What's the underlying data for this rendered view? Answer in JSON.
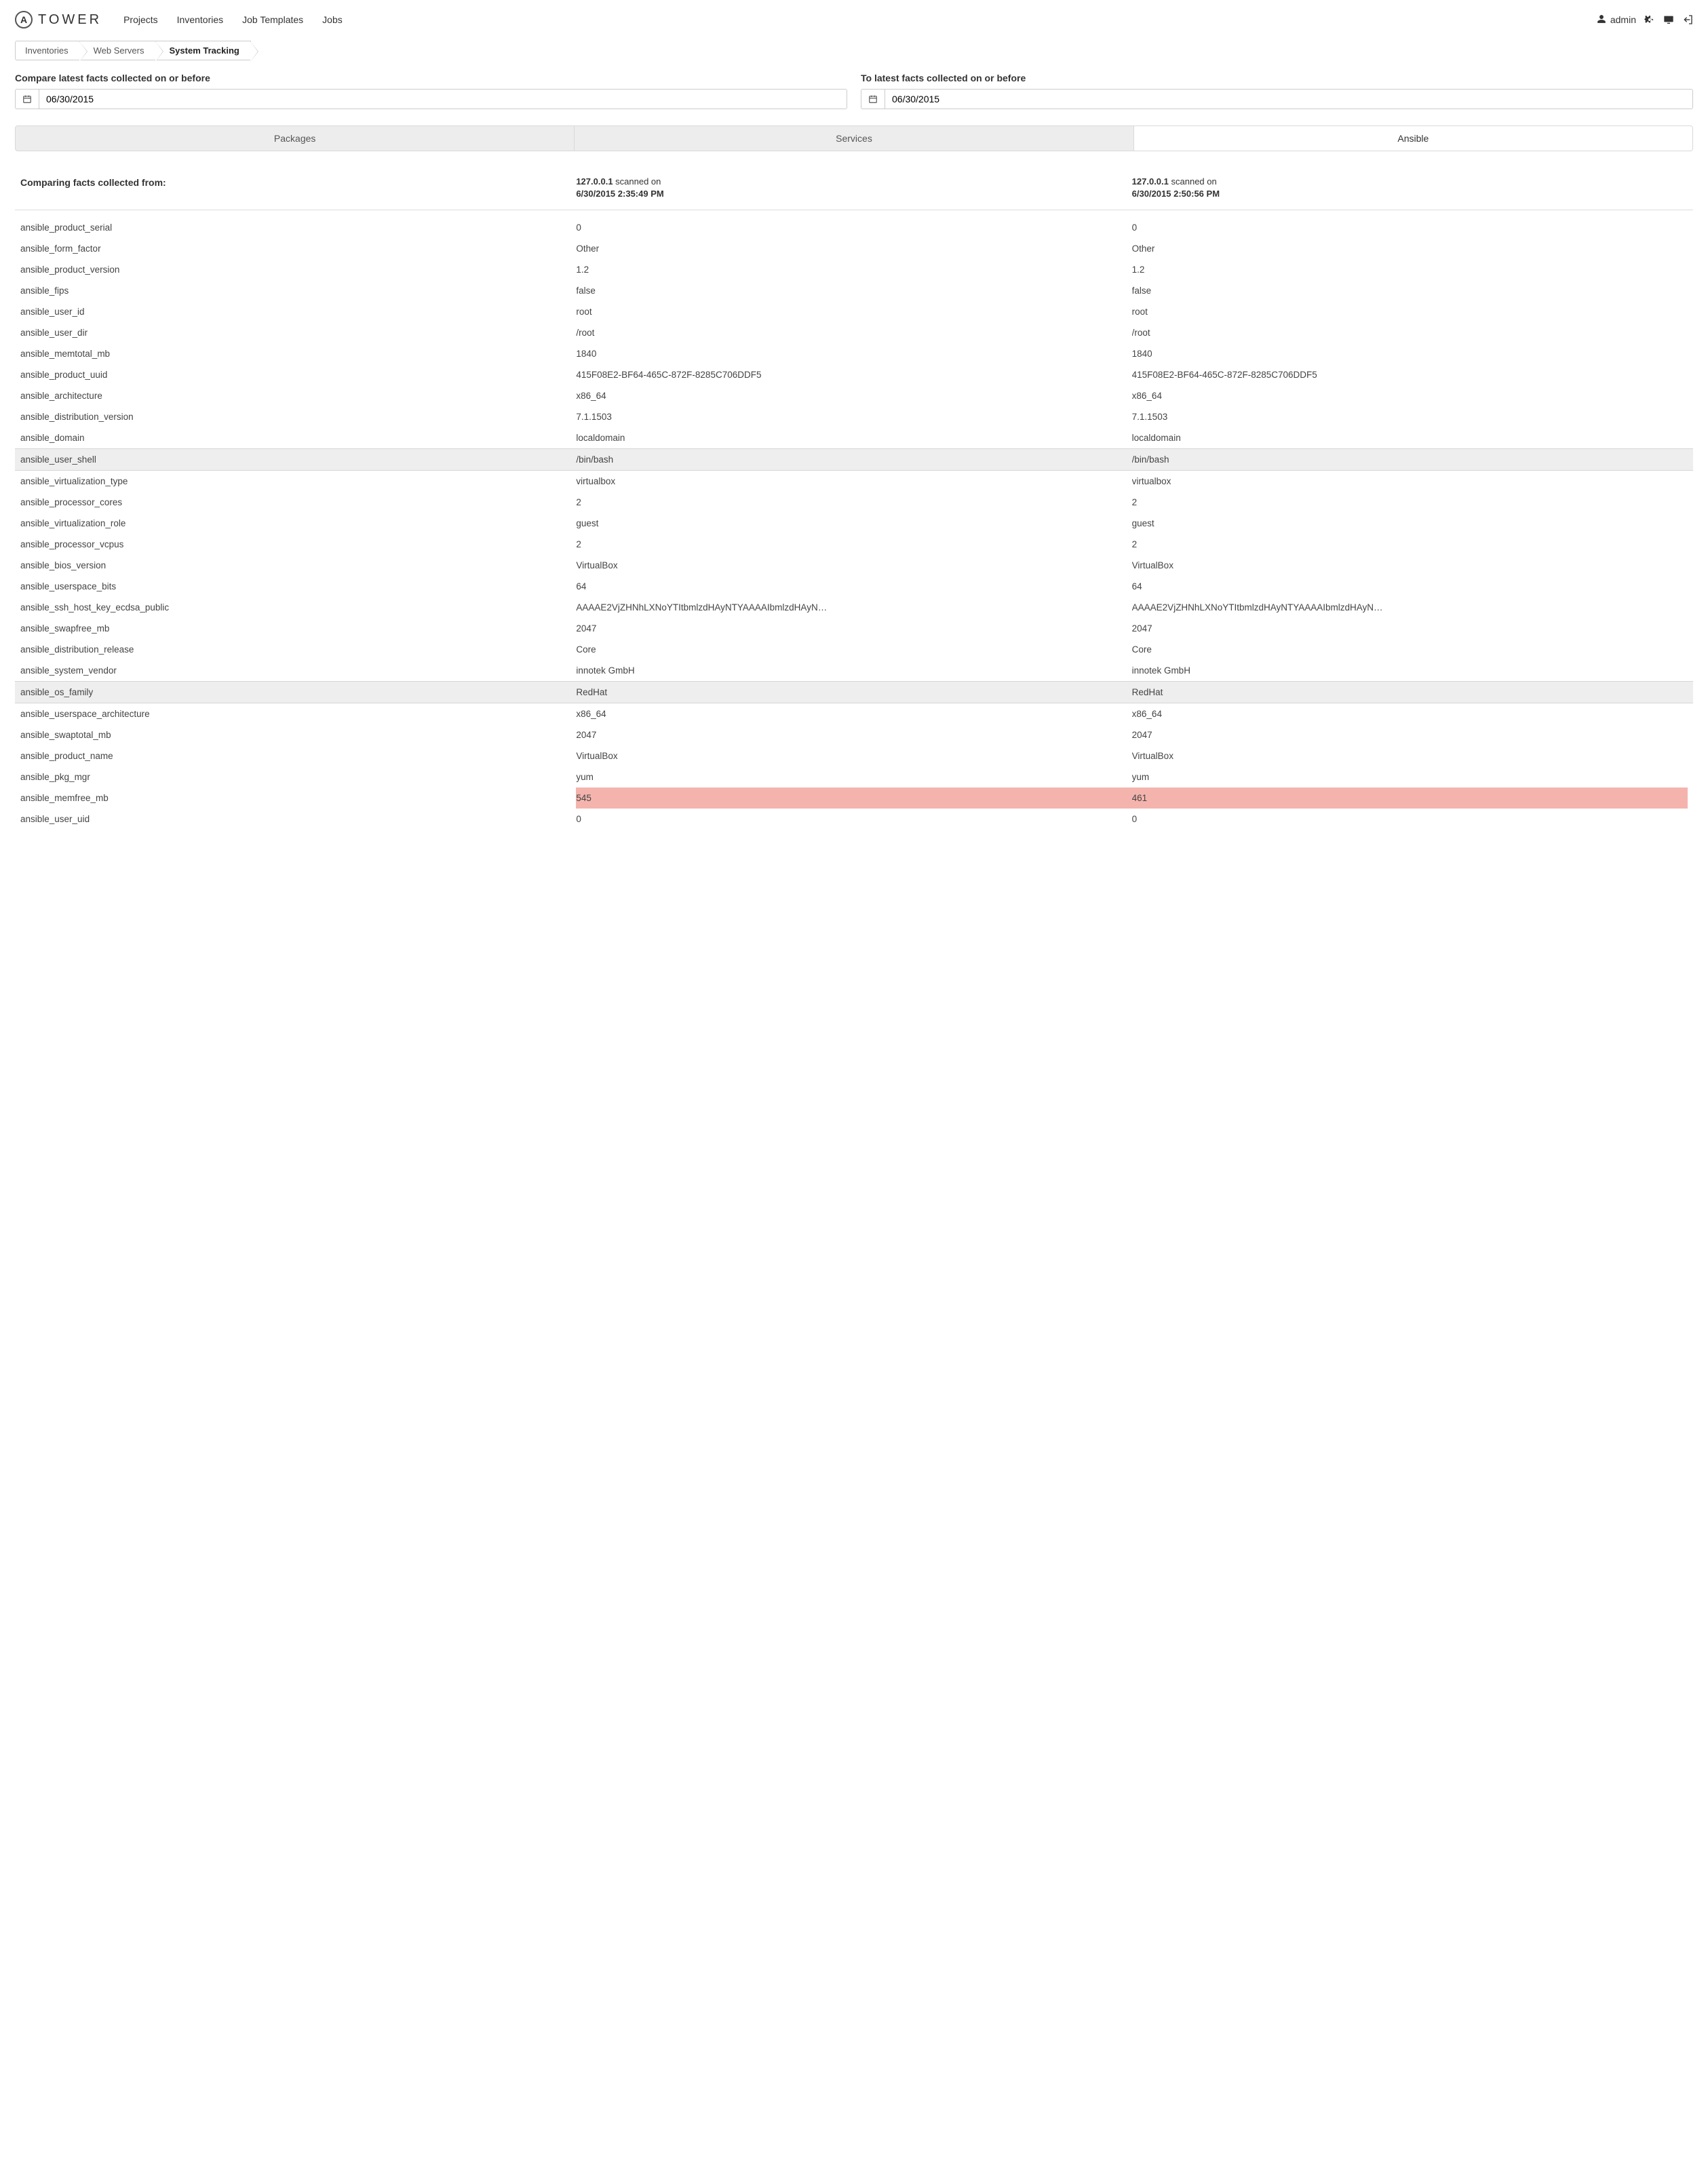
{
  "header": {
    "logo_letter": "A",
    "logo_text": "TOWER",
    "nav": [
      "Projects",
      "Inventories",
      "Job Templates",
      "Jobs"
    ],
    "user": "admin"
  },
  "breadcrumb": {
    "items": [
      "Inventories",
      "Web Servers",
      "System Tracking"
    ],
    "active_index": 2
  },
  "compare": {
    "left_label": "Compare latest facts collected on or before",
    "right_label": "To latest facts collected on or before",
    "left_date": "06/30/2015",
    "right_date": "06/30/2015"
  },
  "tabs": {
    "items": [
      "Packages",
      "Services",
      "Ansible"
    ],
    "active_index": 2
  },
  "comparison": {
    "label": "Comparing facts collected from:",
    "scan1": {
      "ip": "127.0.0.1",
      "suffix": "scanned on",
      "ts": "6/30/2015 2:35:49 PM"
    },
    "scan2": {
      "ip": "127.0.0.1",
      "suffix": "scanned on",
      "ts": "6/30/2015 2:50:56 PM"
    }
  },
  "facts": [
    {
      "key": "ansible_product_serial",
      "v1": "0",
      "v2": "0"
    },
    {
      "key": "ansible_form_factor",
      "v1": "Other",
      "v2": "Other"
    },
    {
      "key": "ansible_product_version",
      "v1": "1.2",
      "v2": "1.2"
    },
    {
      "key": "ansible_fips",
      "v1": "false",
      "v2": "false"
    },
    {
      "key": "ansible_user_id",
      "v1": "root",
      "v2": "root"
    },
    {
      "key": "ansible_user_dir",
      "v1": "/root",
      "v2": "/root"
    },
    {
      "key": "ansible_memtotal_mb",
      "v1": "1840",
      "v2": "1840"
    },
    {
      "key": "ansible_product_uuid",
      "v1": "415F08E2-BF64-465C-872F-8285C706DDF5",
      "v2": "415F08E2-BF64-465C-872F-8285C706DDF5"
    },
    {
      "key": "ansible_architecture",
      "v1": "x86_64",
      "v2": "x86_64"
    },
    {
      "key": "ansible_distribution_version",
      "v1": "7.1.1503",
      "v2": "7.1.1503"
    },
    {
      "key": "ansible_domain",
      "v1": "localdomain",
      "v2": "localdomain"
    },
    {
      "key": "ansible_user_shell",
      "v1": "/bin/bash",
      "v2": "/bin/bash",
      "hl": "grey"
    },
    {
      "key": "ansible_virtualization_type",
      "v1": "virtualbox",
      "v2": "virtualbox"
    },
    {
      "key": "ansible_processor_cores",
      "v1": "2",
      "v2": "2"
    },
    {
      "key": "ansible_virtualization_role",
      "v1": "guest",
      "v2": "guest"
    },
    {
      "key": "ansible_processor_vcpus",
      "v1": "2",
      "v2": "2"
    },
    {
      "key": "ansible_bios_version",
      "v1": "VirtualBox",
      "v2": "VirtualBox"
    },
    {
      "key": "ansible_userspace_bits",
      "v1": "64",
      "v2": "64"
    },
    {
      "key": "ansible_ssh_host_key_ecdsa_public",
      "v1": "AAAAE2VjZHNhLXNoYTItbmlzdHAyNTYAAAAIbmlzdHAyN…",
      "v2": "AAAAE2VjZHNhLXNoYTItbmlzdHAyNTYAAAAIbmlzdHAyN…"
    },
    {
      "key": "ansible_swapfree_mb",
      "v1": "2047",
      "v2": "2047"
    },
    {
      "key": "ansible_distribution_release",
      "v1": "Core",
      "v2": "Core"
    },
    {
      "key": "ansible_system_vendor",
      "v1": "innotek GmbH",
      "v2": "innotek GmbH"
    },
    {
      "key": "ansible_os_family",
      "v1": "RedHat",
      "v2": "RedHat",
      "hl": "grey"
    },
    {
      "key": "ansible_userspace_architecture",
      "v1": "x86_64",
      "v2": "x86_64"
    },
    {
      "key": "ansible_swaptotal_mb",
      "v1": "2047",
      "v2": "2047"
    },
    {
      "key": "ansible_product_name",
      "v1": "VirtualBox",
      "v2": "VirtualBox"
    },
    {
      "key": "ansible_pkg_mgr",
      "v1": "yum",
      "v2": "yum"
    },
    {
      "key": "ansible_memfree_mb",
      "v1": "545",
      "v2": "461",
      "hl": "diff"
    },
    {
      "key": "ansible_user_uid",
      "v1": "0",
      "v2": "0"
    }
  ]
}
